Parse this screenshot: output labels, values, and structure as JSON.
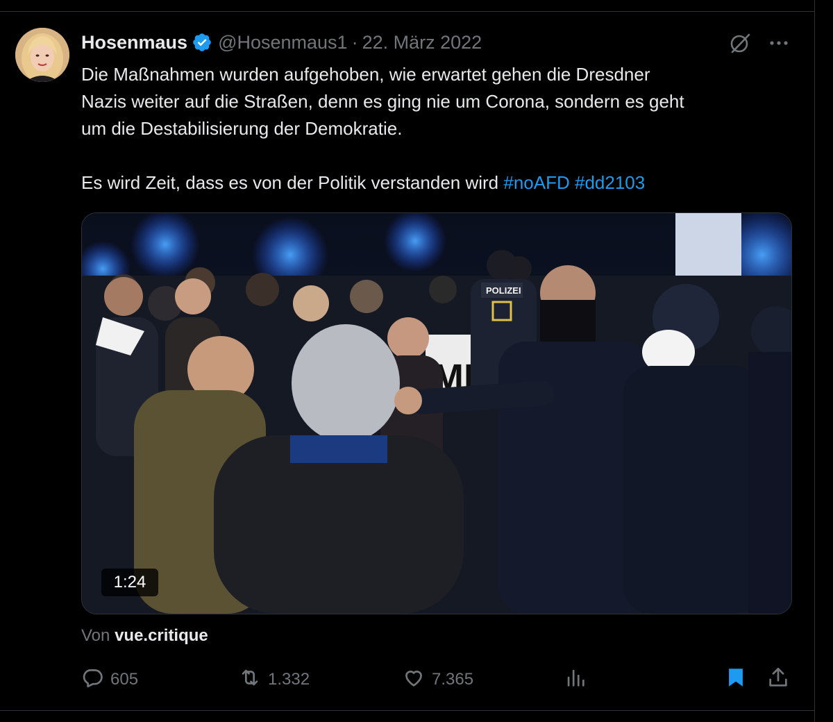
{
  "author": {
    "name": "Hosenmaus",
    "handle": "@Hosenmaus1",
    "separator": "·",
    "date": "22. März 2022"
  },
  "tweet": {
    "line1": "Die Maßnahmen wurden aufgehoben, wie erwartet gehen die Dresdner",
    "line2": "Nazis weiter auf die Straßen, denn es ging nie um Corona, sondern es geht",
    "line3": "um die Destabilisierung der Demokratie.",
    "line4": "Es wird Zeit, dass es von der Politik verstanden wird",
    "hashtags": [
      "#noAFD",
      "#dd2103"
    ]
  },
  "media": {
    "duration": "1:24",
    "police_patch": "POLIZEI",
    "banner_text": "MI"
  },
  "source": {
    "prefix": "Von",
    "name": "vue.critique"
  },
  "actions": {
    "replies": "605",
    "reposts": "1.332",
    "likes": "7.365"
  },
  "icons": {
    "verified": "verified-badge-icon",
    "grok": "grok-icon",
    "more": "more-icon",
    "reply": "reply-icon",
    "repost": "repost-icon",
    "like": "like-icon",
    "views": "views-icon",
    "bookmark": "bookmark-icon",
    "share": "share-icon"
  },
  "colors": {
    "background": "#000000",
    "text": "#e7e9ea",
    "muted": "#71767b",
    "accent": "#1d9bf0",
    "border": "#2f3336"
  }
}
